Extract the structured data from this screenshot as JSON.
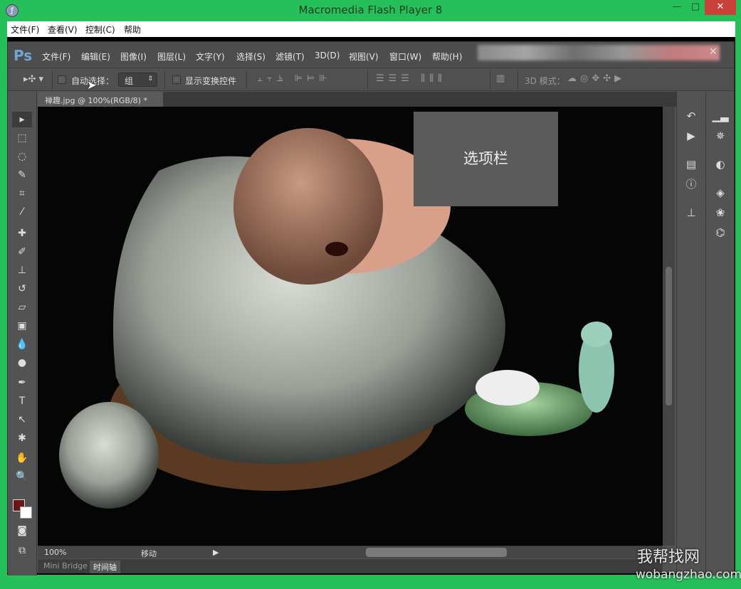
{
  "window": {
    "title": "Macromedia Flash Player 8",
    "controls": [
      "minimize",
      "maximize",
      "close"
    ]
  },
  "flash_menu": [
    "文件(F)",
    "查看(V)",
    "控制(C)",
    "帮助"
  ],
  "ps_menu": [
    "文件(F)",
    "编辑(E)",
    "图像(I)",
    "图层(L)",
    "文字(Y)",
    "选择(S)",
    "滤镜(T)",
    "3D(D)",
    "视图(V)",
    "窗口(W)",
    "帮助(H)"
  ],
  "ps_logo": "Ps",
  "options": {
    "auto_select": "自动选择：",
    "auto_select_checked": false,
    "group_value": "组",
    "show_transform": "显示变换控件",
    "show_transform_checked": false,
    "mode_3d": "3D 模式："
  },
  "document": {
    "tab": "禅趣.jpg @ 100%(RGB/8) *",
    "close": "×"
  },
  "overlay_label": "选项栏",
  "status": {
    "zoom": "100%",
    "info": "移动"
  },
  "bottom_tabs": [
    "Mini Bridge",
    "时间轴"
  ],
  "foreground_color": "#6b1616",
  "background_color": "#ffffff",
  "watermark": {
    "name": "我帮找网",
    "url": "wobangzhao.com"
  }
}
